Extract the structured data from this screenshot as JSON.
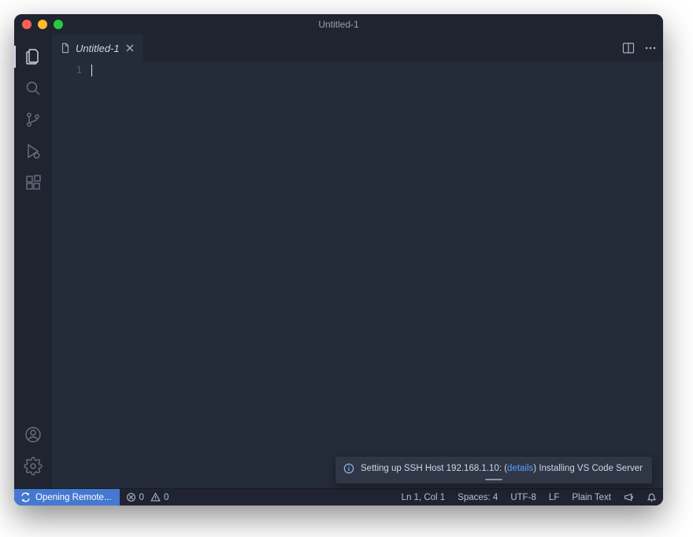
{
  "title": "Untitled-1",
  "tabs": [
    {
      "label": "Untitled-1"
    }
  ],
  "editor": {
    "line_numbers": [
      "1"
    ]
  },
  "notification": {
    "prefix": "Setting up SSH Host 192.168.1.10: (",
    "link": "details",
    "suffix": ") Installing VS Code Server"
  },
  "statusbar": {
    "remote": "Opening Remote...",
    "errors": "0",
    "warnings": "0",
    "cursor": "Ln 1, Col 1",
    "spaces": "Spaces: 4",
    "encoding": "UTF-8",
    "eol": "LF",
    "language": "Plain Text"
  }
}
